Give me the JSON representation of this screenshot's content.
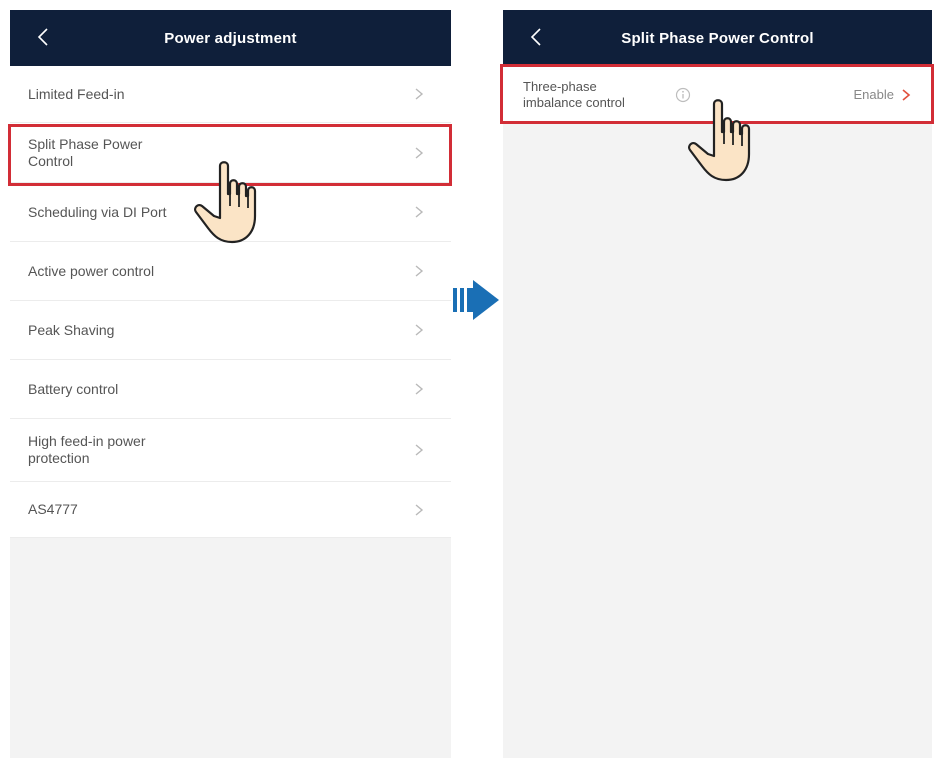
{
  "left": {
    "title": "Power adjustment",
    "items": [
      {
        "label": "Limited Feed-in"
      },
      {
        "label": "Split Phase Power Control",
        "lines": [
          "Split Phase Power",
          "Control"
        ]
      },
      {
        "label": "Scheduling via DI Port"
      },
      {
        "label": "Active power control"
      },
      {
        "label": "Peak Shaving"
      },
      {
        "label": "Battery control"
      },
      {
        "label": "High feed-in power protection",
        "lines": [
          "High feed-in power",
          "protection"
        ]
      },
      {
        "label": "AS4777"
      }
    ]
  },
  "right": {
    "title": "Split Phase Power Control",
    "item": {
      "lines": [
        "Three-phase",
        "imbalance control"
      ],
      "value": "Enable"
    }
  },
  "colors": {
    "header_bg": "#0f1f3a",
    "highlight": "#d22d36",
    "arrow": "#1a6fb5",
    "hand_fill": "#fbe4c6"
  },
  "icons": [
    "back-chevron-icon",
    "chevron-right-icon",
    "info-icon",
    "pointing-hand-icon",
    "next-arrow-icon"
  ]
}
